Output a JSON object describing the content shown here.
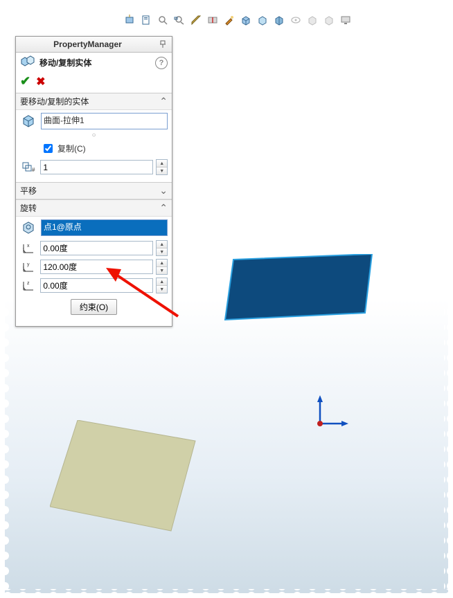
{
  "toolbar_icons": [
    "plane-icon",
    "doc-icon",
    "search-icon",
    "zoom-icon",
    "measure-icon",
    "section-icon",
    "paint-icon",
    "cube1-icon",
    "cube2-icon",
    "cube3-icon",
    "eye-icon",
    "display1-icon",
    "display2-icon",
    "monitor-icon"
  ],
  "pm": {
    "title": "PropertyManager",
    "feature": "移动/复制实体",
    "help": "?",
    "sections": {
      "bodies": {
        "title": "要移动/复制的实体",
        "selection": "曲面-拉伸1",
        "copy_checkbox_checked": true,
        "copy_label": "复制(C)",
        "count_value": "1"
      },
      "translate": {
        "title": "平移"
      },
      "rotate": {
        "title": "旋转",
        "ref_selection": "点1@原点",
        "angle_x": "0.00度",
        "angle_y": "120.00度",
        "angle_z": "0.00度"
      }
    },
    "constrain_button": "约束(O)"
  }
}
